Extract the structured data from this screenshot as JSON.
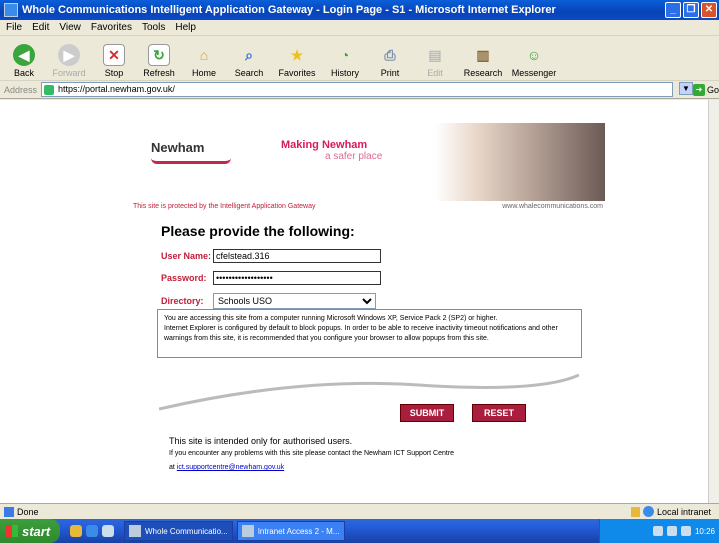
{
  "window": {
    "title": "Whole Communications Intelligent Application Gateway - Login Page - S1 - Microsoft Internet Explorer",
    "controls": [
      "_",
      "❐",
      "✕"
    ]
  },
  "menu": [
    "File",
    "Edit",
    "View",
    "Favorites",
    "Tools",
    "Help"
  ],
  "toolbar": {
    "buttons": [
      {
        "label": "Back",
        "icon": "back-arrow-icon",
        "color": "#3aa53a"
      },
      {
        "label": "Forward",
        "icon": "forward-arrow-icon",
        "color": "#aaaaaa"
      },
      {
        "label": "Stop",
        "icon": "stop-icon",
        "color": "#d03030"
      },
      {
        "label": "Refresh",
        "icon": "refresh-icon",
        "color": "#3aa53a"
      },
      {
        "label": "Home",
        "icon": "home-icon",
        "color": "#e0a030"
      },
      {
        "label": "Search",
        "icon": "search-icon",
        "color": "#3b6fd8"
      },
      {
        "label": "Favorites",
        "icon": "favorites-star-icon",
        "color": "#f0c020"
      },
      {
        "label": "History",
        "icon": "history-icon",
        "color": "#3aa53a"
      },
      {
        "label": "Print",
        "icon": "print-icon",
        "color": "#7a8fb0"
      },
      {
        "label": "Edit",
        "icon": "edit-icon",
        "color": "#bbbbbb"
      },
      {
        "label": "Research",
        "icon": "research-icon",
        "color": "#8a6a3a"
      },
      {
        "label": "Messenger",
        "icon": "messenger-icon",
        "color": "#3aa53a"
      }
    ]
  },
  "address": {
    "label": "Address",
    "url": "https://portal.newham.gov.uk/",
    "go": "Go"
  },
  "page": {
    "logo": "Newham",
    "tagline1": "Making Newham",
    "tagline2": "a safer place",
    "protected_text": "This site is protected by the Intelligent Application Gateway",
    "website": "www.whalecommunications.com",
    "prompt": "Please provide the following:",
    "username_label": "User Name:",
    "username_value": "cfelstead.316",
    "password_label": "Password:",
    "password_value": "••••••••••••••••••",
    "directory_label": "Directory:",
    "directory_value": "Schools USO",
    "notice_line1": "You are accessing this site from a computer running Microsoft Windows XP, Service Pack 2 (SP2) or higher.",
    "notice_line2": "Internet Explorer is configured by default to block popups. In order to be able to receive inactivity timeout notifications and other warnings from this site, it is recommended that you configure your browser to allow popups from this site.",
    "submit": "SUBMIT",
    "reset": "RESET",
    "info1": "This site is intended only for authorised users.",
    "info2": "If you encounter any problems with this site please contact the Newham ICT Support Centre",
    "info3_prefix": "at",
    "info3_link": "ict.supportcentre@newham.gov.uk"
  },
  "status": {
    "text": "Done",
    "zone": "Local intranet"
  },
  "taskbar": {
    "start": "start",
    "tasks": [
      "Whole Communicatio...",
      "Intranet Access 2 - M..."
    ],
    "clock": "10:26"
  }
}
